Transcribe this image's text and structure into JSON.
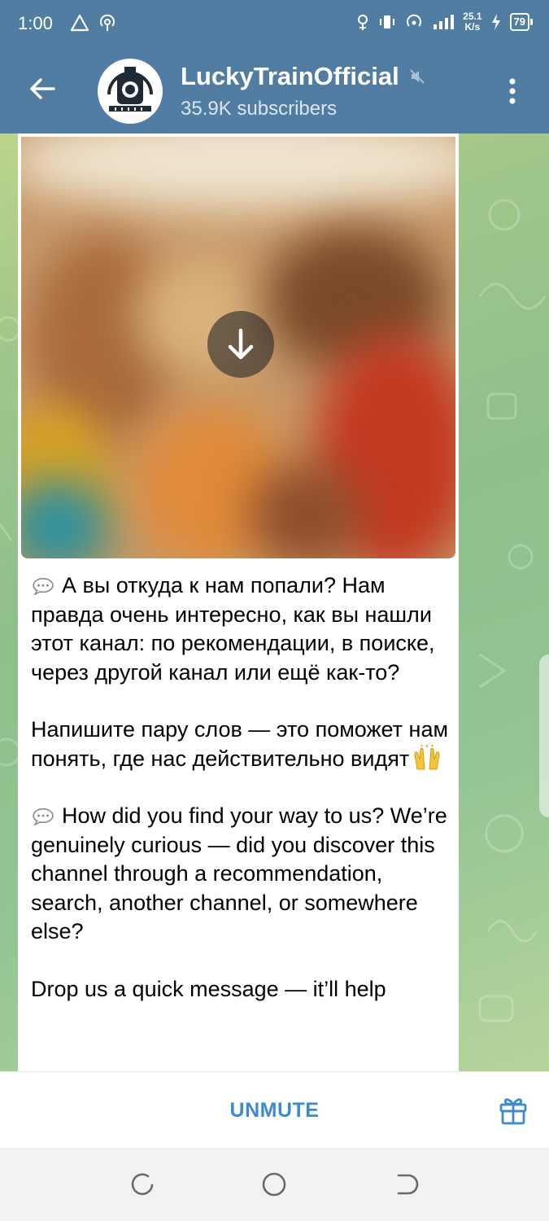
{
  "status_bar": {
    "time": "1:00",
    "left_icons": [
      "warning-triangle-icon",
      "hotspot-icon"
    ],
    "speed": "25.1",
    "speed_unit": "K/s",
    "battery": "79"
  },
  "header": {
    "channel_name": "LuckyTrainOfficial",
    "subscribers": "35.9K subscribers",
    "muted": true
  },
  "message": {
    "paragraphs": [
      "А вы откуда к нам попали? Нам правда очень интересно, как вы нашли этот канал: по рекомендации, в поиске, через другой канал или ещё как-то?",
      "Напишите пару слов — это поможет нам понять, где нас действительно видят",
      "How did you find your way to us? We’re genuinely curious — did you discover this channel through a recommendation, search, another channel, or somewhere else?",
      "Drop us a quick message — it’ll help"
    ]
  },
  "bottom": {
    "unmute_label": "UNMUTE"
  },
  "colors": {
    "header": "#527da3",
    "accent": "#3e8ad2"
  }
}
